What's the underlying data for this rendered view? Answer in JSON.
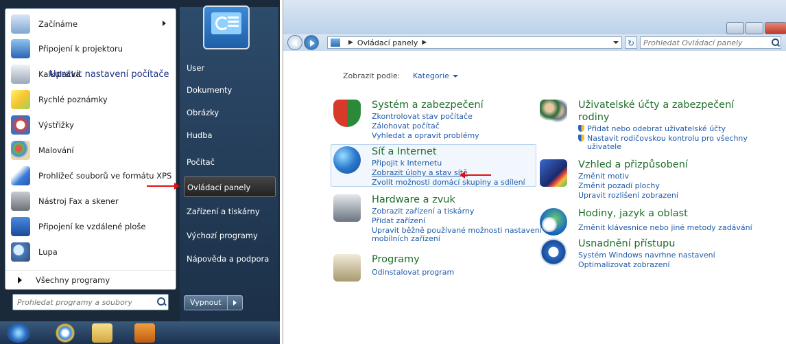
{
  "start_menu": {
    "programs": [
      {
        "label": "Začínáme",
        "icon": "getting-started-icon",
        "submenu": true
      },
      {
        "label": "Připojení k projektoru",
        "icon": "projector-icon"
      },
      {
        "label": "Kalkulačka",
        "icon": "calculator-icon"
      },
      {
        "label": "Rychlé poznámky",
        "icon": "sticky-notes-icon"
      },
      {
        "label": "Výstřižky",
        "icon": "snipping-tool-icon"
      },
      {
        "label": "Malování",
        "icon": "paint-icon"
      },
      {
        "label": "Prohlížeč souborů ve formátu XPS",
        "icon": "xps-viewer-icon"
      },
      {
        "label": "Nástroj Fax a skener",
        "icon": "fax-scanner-icon"
      },
      {
        "label": "Připojení ke vzdálené ploše",
        "icon": "remote-desktop-icon"
      },
      {
        "label": "Lupa",
        "icon": "magnifier-icon"
      }
    ],
    "all_programs": "Všechny programy",
    "search_placeholder": "Prohledat programy a soubory",
    "right_items": [
      "User",
      "Dokumenty",
      "Obrázky",
      "Hudba",
      "Počítač",
      "Ovládací panely",
      "Zařízení a tiskárny",
      "Výchozí programy",
      "Nápověda a podpora"
    ],
    "selected_right": "Ovládací panely",
    "shutdown_label": "Vypnout"
  },
  "control_panel": {
    "breadcrumb": "Ovládací panely",
    "search_placeholder": "Prohledat Ovládací panely",
    "heading": "Upravit nastavení počítače",
    "view_by_label": "Zobrazit podle:",
    "view_by_value": "Kategorie",
    "left_categories": [
      {
        "title": "Systém a zabezpečení",
        "icon": "system-security-shield-icon",
        "links": [
          "Zkontrolovat stav počítače",
          "Zálohovat počítač",
          "Vyhledat a opravit problémy"
        ]
      },
      {
        "title": "Síť a Internet",
        "icon": "network-globe-icon",
        "links": [
          "Připojit k Internetu",
          "Zobrazit úlohy a stav sítě",
          "Zvolit možnosti domácí skupiny a sdílení"
        ]
      },
      {
        "title": "Hardware a zvuk",
        "icon": "printer-hardware-icon",
        "links": [
          "Zobrazit zařízení a tiskárny",
          "Přidat zařízení",
          "Upravit běžně používané možnosti nastavení",
          "mobilních zařízení"
        ]
      },
      {
        "title": "Programy",
        "icon": "programs-box-icon",
        "links": [
          "Odinstalovat program"
        ]
      }
    ],
    "right_categories": [
      {
        "title_line1": "Uživatelské účty a zabezpečení",
        "title_line2": "rodiny",
        "icon": "user-accounts-icon",
        "links": [
          "Přidat nebo odebrat uživatelské účty",
          "Nastavit rodičovskou kontrolu pro všechny",
          "uživatele"
        ]
      },
      {
        "title": "Vzhled a přizpůsobení",
        "icon": "appearance-display-icon",
        "links": [
          "Změnit motiv",
          "Změnit pozadí plochy",
          "Upravit rozlišení zobrazení"
        ]
      },
      {
        "title": "Hodiny, jazyk a oblast",
        "icon": "clock-globe-icon",
        "links": [
          "Změnit klávesnice nebo jiné metody zadávání"
        ]
      },
      {
        "title": "Usnadnění přístupu",
        "icon": "ease-of-access-icon",
        "links": [
          "Systém Windows navrhne nastavení",
          "Optimalizovat zobrazení"
        ]
      }
    ]
  }
}
